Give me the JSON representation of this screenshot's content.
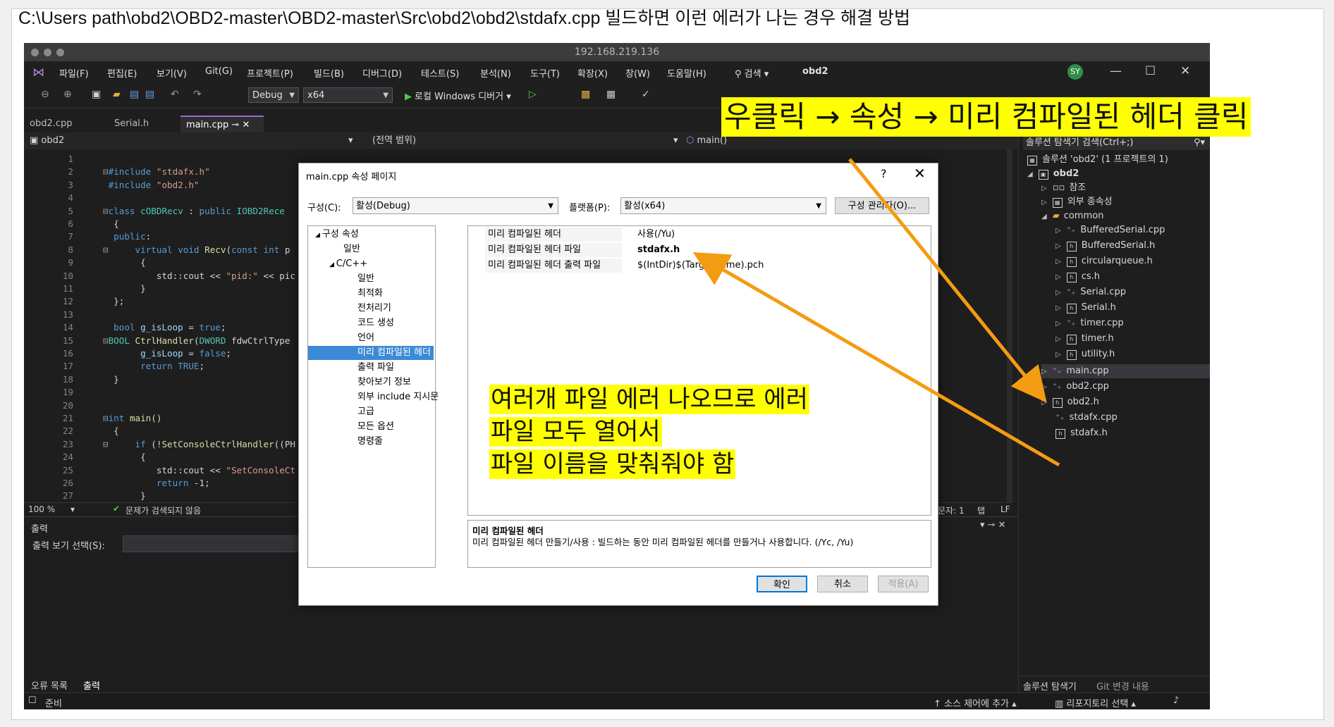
{
  "page": {
    "caption": "C:\\Users path\\obd2\\OBD2-master\\OBD2-master\\Src\\obd2\\obd2\\stdafx.cpp  빌드하면 이런 에러가 나는 경우 해결 방법"
  },
  "window": {
    "host": "192.168.219.136",
    "menu": [
      "파일(F)",
      "편집(E)",
      "보기(V)",
      "Git(G)",
      "프로젝트(P)",
      "빌드(B)",
      "디버그(D)",
      "테스트(S)",
      "분석(N)",
      "도구(T)",
      "확장(X)",
      "창(W)",
      "도움말(H)"
    ],
    "search_label": "검색",
    "solution_name": "obd2",
    "user_initials": "SY"
  },
  "toolbar": {
    "config": "Debug",
    "platform": "x64",
    "run_label": "로컬 Windows 디버거"
  },
  "tabs": [
    {
      "label": "obd2.cpp"
    },
    {
      "label": "Serial.h"
    },
    {
      "label": "main.cpp"
    }
  ],
  "navbar": {
    "project": "obd2",
    "scope": "(전역 범위)",
    "member": "main()"
  },
  "editor": {
    "lines": [
      {
        "n": "1",
        "html": ""
      },
      {
        "n": "2",
        "html": "<span style='color:#9b9b9b'>⊟</span><span class='kw'>#include</span> <span class='str'>\"stdafx.h\"</span>"
      },
      {
        "n": "3",
        "html": " <span class='kw'>#include</span> <span class='str'>\"obd2.h\"</span>"
      },
      {
        "n": "4",
        "html": ""
      },
      {
        "n": "5",
        "html": "<span style='color:#9b9b9b'>⊟</span><span class='kw'>class</span> <span class='ty'>cOBDRecv</span> : <span class='kw'>public</span> <span class='ty'>IOBD2Rece</span>"
      },
      {
        "n": "6",
        "html": "  {"
      },
      {
        "n": "7",
        "html": "  <span class='kw'>public</span>:"
      },
      {
        "n": "8",
        "html": "<span style='color:#9b9b9b'>⊟</span>     <span class='kw'>virtual</span> <span class='kw'>void</span> <span class='fn'>Recv</span>(<span class='kw'>const</span> <span class='kw'>int</span> p"
      },
      {
        "n": "9",
        "html": "       {"
      },
      {
        "n": "10",
        "html": "          std::cout &lt;&lt; <span class='str'>\"pid:\"</span> &lt;&lt; pic"
      },
      {
        "n": "11",
        "html": "       }"
      },
      {
        "n": "12",
        "html": "  };"
      },
      {
        "n": "13",
        "html": ""
      },
      {
        "n": "14",
        "html": "  <span class='kw'>bool</span> <span class='var'>g_isLoop</span> = <span class='kw'>true</span>;"
      },
      {
        "n": "15",
        "html": "<span style='color:#9b9b9b'>⊟</span><span class='ty'>BOOL</span> <span class='fn'>CtrlHandler</span>(<span class='ty'>DWORD</span> fdwCtrlType"
      },
      {
        "n": "16",
        "html": "       <span class='var'>g_isLoop</span> = <span class='kw'>false</span>;"
      },
      {
        "n": "17",
        "html": "       <span class='kw'>return</span> <span class='kw'>TRUE</span>;"
      },
      {
        "n": "18",
        "html": "  }"
      },
      {
        "n": "19",
        "html": ""
      },
      {
        "n": "20",
        "html": ""
      },
      {
        "n": "21",
        "html": "<span style='color:#9b9b9b'>⊟</span><span class='kw'>int</span> <span class='fn'>main</span>()"
      },
      {
        "n": "22",
        "html": "  {"
      },
      {
        "n": "23",
        "html": "<span style='color:#9b9b9b'>⊟</span>     <span class='kw'>if</span> (!<span class='fn'>SetConsoleCtrlHandler</span>((PH"
      },
      {
        "n": "24",
        "html": "       {"
      },
      {
        "n": "25",
        "html": "          std::cout &lt;&lt; <span class='str'>\"SetConsoleCt</span>"
      },
      {
        "n": "26",
        "html": "          <span class='kw'>return</span> -1;"
      },
      {
        "n": "27",
        "html": "       }"
      }
    ]
  },
  "editor_status": {
    "zoom": "100 %",
    "issues": "문제가 검색되지 않음",
    "chars": "문자: 1",
    "tab": "탭",
    "eol": "LF"
  },
  "output": {
    "title": "출력",
    "source_label": "출력 보기 선택(S):"
  },
  "bottom_tabs": [
    "오류 목록",
    "출력"
  ],
  "statusbar": {
    "ready": "준비",
    "add_source": "소스 제어에 추가",
    "select_repo": "리포지토리 선택"
  },
  "solution_explorer": {
    "search": "솔루션 탐색기 검색(Ctrl+;)",
    "solution": "솔루션 'obd2' (1 프로젝트의 1)",
    "project": "obd2",
    "references": "참조",
    "external_deps": "외부 종속성",
    "common_folder": "common",
    "files": [
      "BufferedSerial.cpp",
      "BufferedSerial.h",
      "circularqueue.h",
      "cs.h",
      "Serial.cpp",
      "Serial.h",
      "timer.cpp",
      "timer.h",
      "utility.h"
    ],
    "root_files": [
      "main.cpp",
      "obd2.cpp",
      "obd2.h",
      "stdafx.cpp",
      "stdafx.h"
    ],
    "tabs": [
      "솔루션 탐색기",
      "Git 변경 내용"
    ]
  },
  "dialog": {
    "title": "main.cpp 속성 페이지",
    "config_label": "구성(C):",
    "config_value": "활성(Debug)",
    "platform_label": "플랫폼(P):",
    "platform_value": "활성(x64)",
    "config_manager": "구성 관리자(O)...",
    "tree": [
      "구성 속성",
      "일반",
      "C/C++",
      "일반",
      "최적화",
      "전처리기",
      "코드 생성",
      "언어",
      "미리 컴파일된 헤더",
      "출력 파일",
      "찾아보기 정보",
      "외부 include 지시문",
      "고급",
      "모든 옵션",
      "명령줄"
    ],
    "props": [
      {
        "name": "미리 컴파일된 헤더",
        "value": "사용(/Yu)"
      },
      {
        "name": "미리 컴파일된 헤더 파일",
        "value": "stdafx.h"
      },
      {
        "name": "미리 컴파일된 헤더 출력 파일",
        "value": "$(IntDir)$(TargetName).pch"
      }
    ],
    "desc_title": "미리 컴파일된 헤더",
    "desc_text": "미리 컴파일된 헤더 만들기/사용 : 빌드하는 동안 미리 컴파일된 헤더를 만들거나 사용합니다.    (/Yc, /Yu)",
    "ok": "확인",
    "cancel": "취소",
    "apply": "적용(A)"
  },
  "annotations": {
    "top": "우클릭 → 속성  → 미리 컴파일된 헤더 클릭",
    "lines": [
      "여러개 파일 에러 나오므로 에러",
      "파일 모두 열어서",
      "파일 이름을 맞춰줘야 함"
    ],
    "arrow_color": "#f39c12",
    "highlight_color": "#ffff00"
  }
}
